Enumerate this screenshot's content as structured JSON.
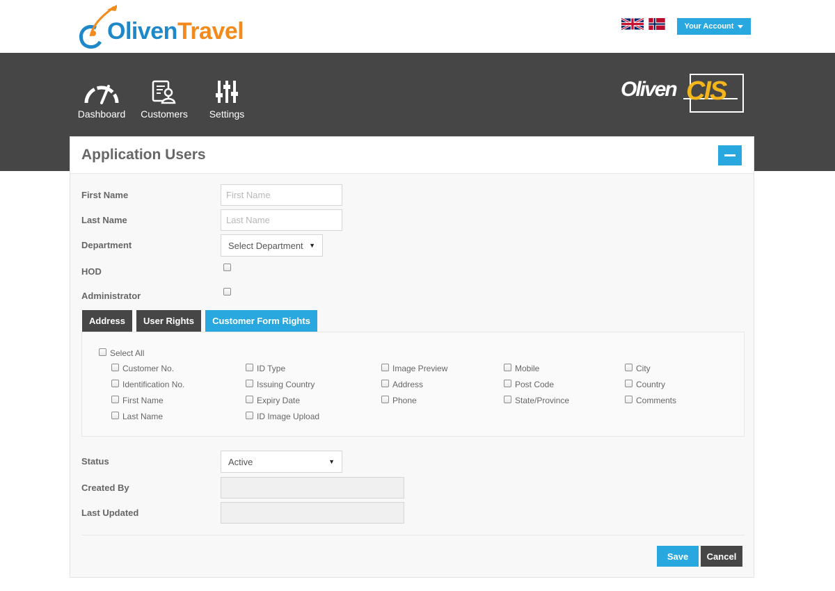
{
  "header": {
    "logo_part1": "Oliven",
    "logo_part2": "Travel",
    "flags": [
      "uk-flag",
      "norway-flag"
    ],
    "account_label": "Your Account"
  },
  "nav": {
    "items": [
      {
        "label": "Dashboard",
        "icon": "gauge-icon"
      },
      {
        "label": "Customers",
        "icon": "customer-form-icon"
      },
      {
        "label": "Settings",
        "icon": "sliders-icon"
      }
    ],
    "brand_part1": "Oliven",
    "brand_part2": "CIS"
  },
  "panel": {
    "title": "Application Users",
    "fields": {
      "first_name_label": "First Name",
      "first_name_placeholder": "First Name",
      "last_name_label": "Last Name",
      "last_name_placeholder": "Last Name",
      "department_label": "Department",
      "department_value": "Select Department",
      "hod_label": "HOD",
      "administrator_label": "Administrator"
    },
    "tabs": [
      "Address",
      "User Rights",
      "Customer Form Rights"
    ],
    "rights": {
      "select_all": "Select All",
      "columns": [
        [
          "Customer No.",
          "Identification No.",
          "First Name",
          "Last Name"
        ],
        [
          "ID Type",
          "Issuing Country",
          "Expiry Date",
          "ID Image Upload"
        ],
        [
          "Image Preview",
          "Address",
          "Phone"
        ],
        [
          "Mobile",
          "Post Code",
          "State/Province"
        ],
        [
          "City",
          "Country",
          "Comments"
        ]
      ]
    },
    "status_label": "Status",
    "status_value": "Active",
    "created_by_label": "Created By",
    "last_updated_label": "Last Updated",
    "save_label": "Save",
    "cancel_label": "Cancel"
  },
  "colors": {
    "accent": "#29a8e0",
    "dark": "#464646",
    "logo_blue": "#1e88c8",
    "logo_orange": "#f28a1c",
    "cis_yellow": "#f2b51c"
  }
}
